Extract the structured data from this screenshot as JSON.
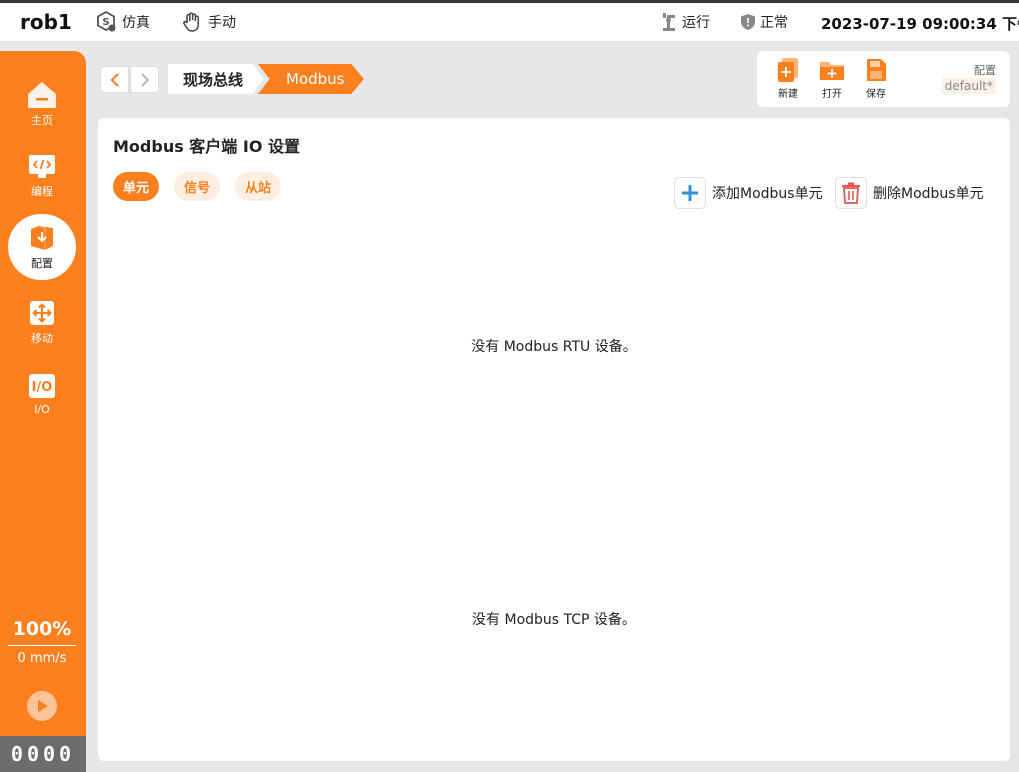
{
  "topbar": {
    "robot_name": "rob1",
    "sim_label": "仿真",
    "manual_label": "手动",
    "run_label": "运行",
    "status_label": "正常",
    "datetime": "2023-07-19 09:00:34 下午"
  },
  "sidebar": {
    "items": [
      {
        "label": "主页",
        "icon": "home-icon"
      },
      {
        "label": "编程",
        "icon": "code-icon"
      },
      {
        "label": "配置",
        "icon": "config-icon"
      },
      {
        "label": "移动",
        "icon": "move-icon"
      },
      {
        "label": "I/O",
        "icon": "io-icon"
      }
    ],
    "speed_percent": "100%",
    "speed_value": "0 mm/s",
    "counter": "0000"
  },
  "breadcrumb": {
    "items": [
      "现场总线",
      "Modbus"
    ]
  },
  "filebar": {
    "new_label": "新建",
    "open_label": "打开",
    "save_label": "保存",
    "config_label": "配置",
    "config_value": "default*"
  },
  "panel": {
    "title": "Modbus 客户端 IO 设置",
    "tabs": [
      "单元",
      "信号",
      "从站"
    ],
    "add_label": "添加Modbus单元",
    "delete_label": "删除Modbus单元",
    "rtu_empty": "没有 Modbus RTU 设备。",
    "tcp_empty": "没有 Modbus TCP 设备。"
  },
  "colors": {
    "accent": "#fe7f1e",
    "accent_light": "#fdeee2",
    "background": "#e6e7e9"
  }
}
